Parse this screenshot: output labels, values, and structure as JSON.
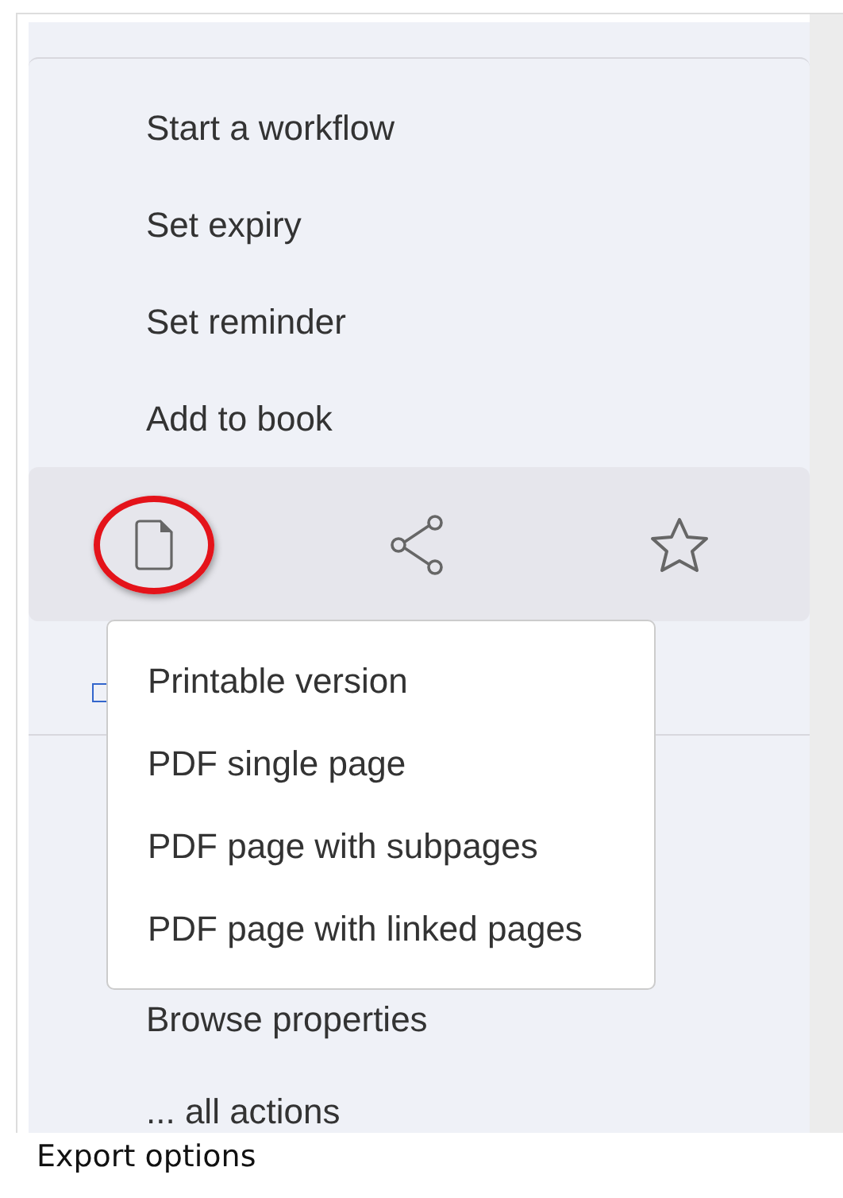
{
  "menu_items": [
    "Start a workflow",
    "Set expiry",
    "Set reminder",
    "Add to book"
  ],
  "action_bar": [
    {
      "kind": "document",
      "highlighted": true
    },
    {
      "kind": "share",
      "highlighted": false
    },
    {
      "kind": "star",
      "highlighted": false
    }
  ],
  "dropdown_items": [
    "Printable version",
    "PDF single page",
    "PDF page with subpages",
    "PDF page with linked pages"
  ],
  "lower_items": [
    "Browse properties",
    "... all actions"
  ],
  "caption": "Export options"
}
